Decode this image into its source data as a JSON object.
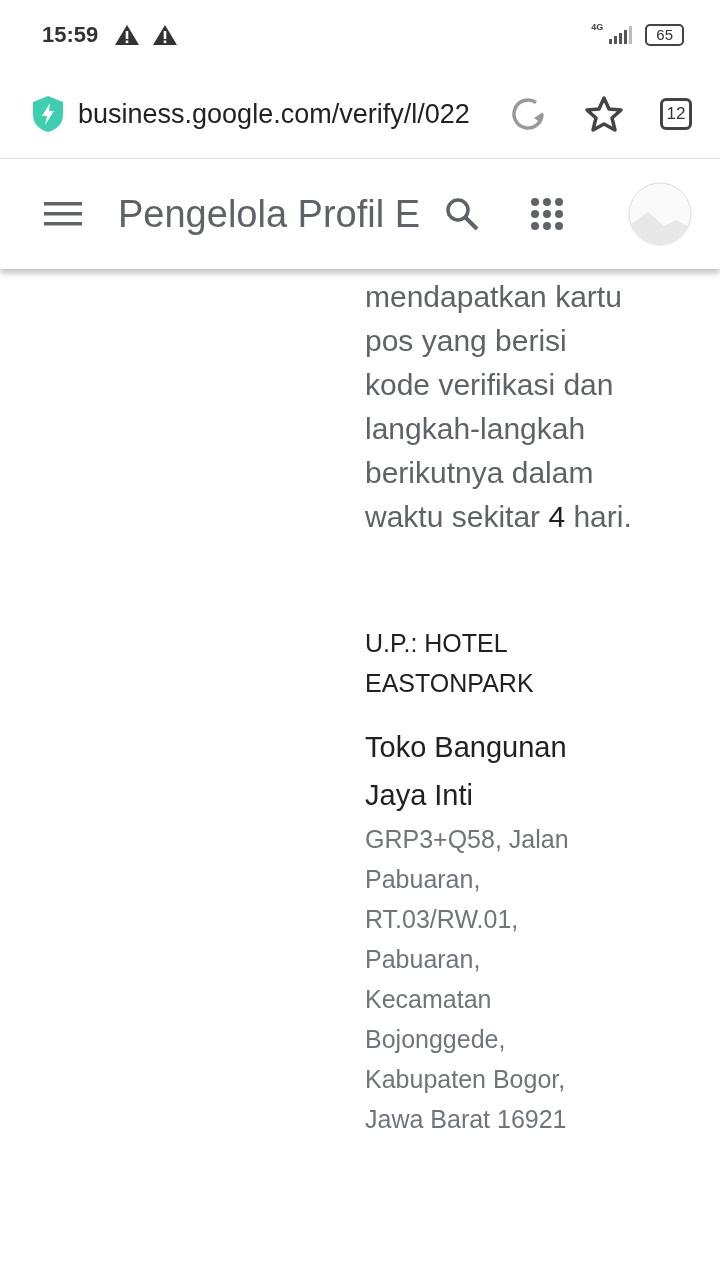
{
  "status_bar": {
    "time": "15:59",
    "network": "4G",
    "battery": "65"
  },
  "browser": {
    "url": "business.google.com/verify/l/022",
    "tab_count": "12"
  },
  "app_bar": {
    "title": "Pengelola Profil E"
  },
  "content": {
    "message": "mendapatkan kartu pos yang berisi kode verifikasi dan langkah-langkah berikutnya dalam waktu sekitar **4** hari.",
    "attention": "U.P.: HOTEL EASTONPARK",
    "business_name": "Toko Bangunan Jaya Inti",
    "address": "GRP3+Q58, Jalan Pabuaran, RT.03/RW.01, Pabuaran, Kecamatan Bojonggede, Kabupaten Bogor, Jawa Barat 16921"
  }
}
